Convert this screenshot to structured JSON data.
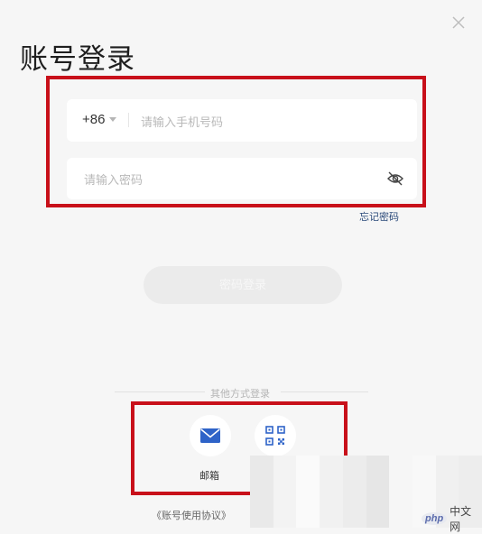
{
  "window": {
    "close_icon": "close-icon"
  },
  "title": "账号登录",
  "phone": {
    "country_code": "+86",
    "placeholder": "请输入手机号码",
    "value": ""
  },
  "password": {
    "placeholder": "请输入密码",
    "value": "",
    "toggle_icon": "eye-hidden-icon"
  },
  "forgot_password": "忘记密码",
  "login_button": "密码登录",
  "other_methods": {
    "label": "其他方式登录",
    "items": [
      {
        "icon": "envelope-icon",
        "label": "邮箱",
        "color": "#2e63c8"
      },
      {
        "icon": "qr-code-icon",
        "label": "",
        "color": "#2e63c8"
      }
    ]
  },
  "agreement": "《账号使用协议》",
  "annotation_color": "#c8101a",
  "watermark": {
    "logo": "php",
    "text": "中文网"
  }
}
